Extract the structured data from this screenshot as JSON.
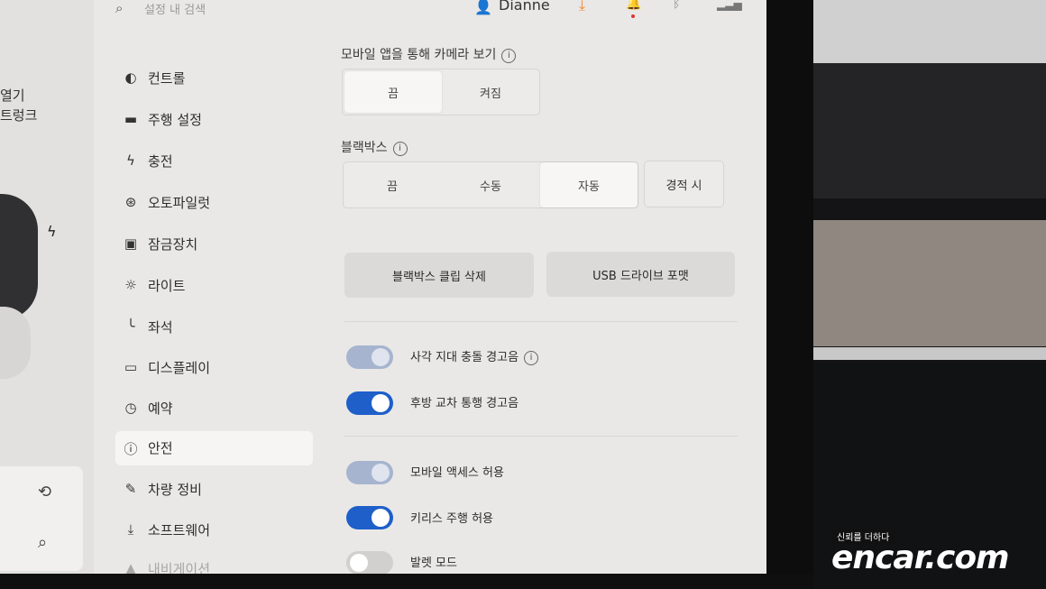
{
  "header": {
    "search_placeholder": "설정 내 검색",
    "user_name": "Dianne"
  },
  "car_panel": {
    "label_1": "열기",
    "label_2": "트렁크"
  },
  "sidebar": {
    "items": [
      {
        "icon": "toggle-icon",
        "glyph": "◐",
        "label": "컨트롤"
      },
      {
        "icon": "car-icon",
        "glyph": "🚗",
        "label": "주행 설정"
      },
      {
        "icon": "bolt-icon",
        "glyph": "ϟ",
        "label": "충전"
      },
      {
        "icon": "steering-wheel-icon",
        "glyph": "⊛",
        "label": "오토파일럿"
      },
      {
        "icon": "lock-icon",
        "glyph": "🔒",
        "label": "잠금장치"
      },
      {
        "icon": "light-icon",
        "glyph": "☼",
        "label": "라이트"
      },
      {
        "icon": "seat-icon",
        "glyph": "╰",
        "label": "좌석"
      },
      {
        "icon": "display-icon",
        "glyph": "▭",
        "label": "디스플레이"
      },
      {
        "icon": "alarm-clock-icon",
        "glyph": "⏰",
        "label": "예약"
      },
      {
        "icon": "safety-icon",
        "glyph": "ⓘ",
        "label": "안전"
      },
      {
        "icon": "wrench-icon",
        "glyph": "🔧",
        "label": "차량 정비"
      },
      {
        "icon": "download-icon",
        "glyph": "⤓",
        "label": "소프트웨어"
      },
      {
        "icon": "navigation-icon",
        "glyph": "▲",
        "label": "내비게이션"
      }
    ],
    "active_index": 9
  },
  "main": {
    "camera_section": {
      "label": "모바일 앱을 통해 카메라 보기",
      "options": [
        "끔",
        "켜짐"
      ],
      "selected": "끔"
    },
    "dashcam_section": {
      "label": "블랙박스",
      "options": [
        "끔",
        "수동",
        "자동"
      ],
      "selected": "자동",
      "honk_button": "경적 시"
    },
    "actions": {
      "delete_clips": "블랙박스 클립 삭제",
      "format_usb": "USB 드라이브 포맷"
    },
    "toggles": [
      {
        "label": "사각 지대 충돌 경고음",
        "state": "on-dimmed",
        "info": true
      },
      {
        "label": "후방 교차 통행 경고음",
        "state": "on",
        "info": false
      },
      {
        "label": "모바일 액세스 허용",
        "state": "on-dimmed",
        "info": false
      },
      {
        "label": "키리스 주행 허용",
        "state": "on",
        "info": false
      },
      {
        "label": "발렛 모드",
        "state": "off",
        "info": false
      }
    ]
  },
  "watermark": {
    "tagline": "신뢰를 더하다",
    "brand": "encar.com"
  },
  "colors": {
    "accent_blue": "#1e5fc9",
    "download_orange": "#f0862e",
    "notification_red": "#dd3333"
  }
}
